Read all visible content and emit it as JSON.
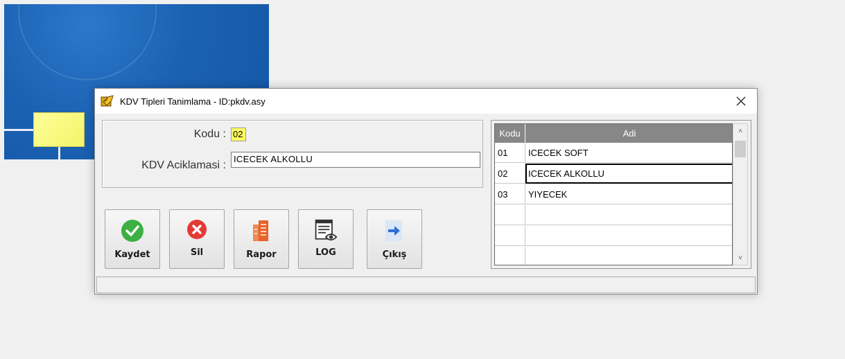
{
  "window": {
    "title": "KDV Tipleri Tanimlama - ID:pkdv.asy",
    "close_label": "✕"
  },
  "form": {
    "kodu_label": "Kodu :",
    "kodu_value": "02",
    "aciklama_label": "KDV Aciklamasi :",
    "aciklama_value": "ICECEK ALKOLLU"
  },
  "buttons": {
    "kaydet": {
      "label": "Kaydet",
      "icon": "check-circle-icon",
      "color": "#3cb043"
    },
    "sil": {
      "label": "Sil",
      "icon": "x-circle-icon",
      "color": "#e53935"
    },
    "rapor": {
      "label": "Rapor",
      "icon": "report-icon",
      "color": "#e8632b"
    },
    "log": {
      "label": "LOG",
      "icon": "log-view-icon",
      "color": "#333333"
    },
    "cikis": {
      "label": "Çıkış",
      "icon": "arrow-right-icon",
      "color": "#2f6fd6"
    }
  },
  "grid": {
    "columns": [
      "Kodu",
      "Adi"
    ],
    "rows": [
      {
        "kodu": "01",
        "adi": "ICECEK SOFT"
      },
      {
        "kodu": "02",
        "adi": "ICECEK ALKOLLU"
      },
      {
        "kodu": "03",
        "adi": "YIYECEK"
      },
      {
        "kodu": "",
        "adi": ""
      },
      {
        "kodu": "",
        "adi": ""
      },
      {
        "kodu": "",
        "adi": ""
      }
    ],
    "selected_index": 1,
    "scroll_up": "˄",
    "scroll_down": "˅"
  }
}
